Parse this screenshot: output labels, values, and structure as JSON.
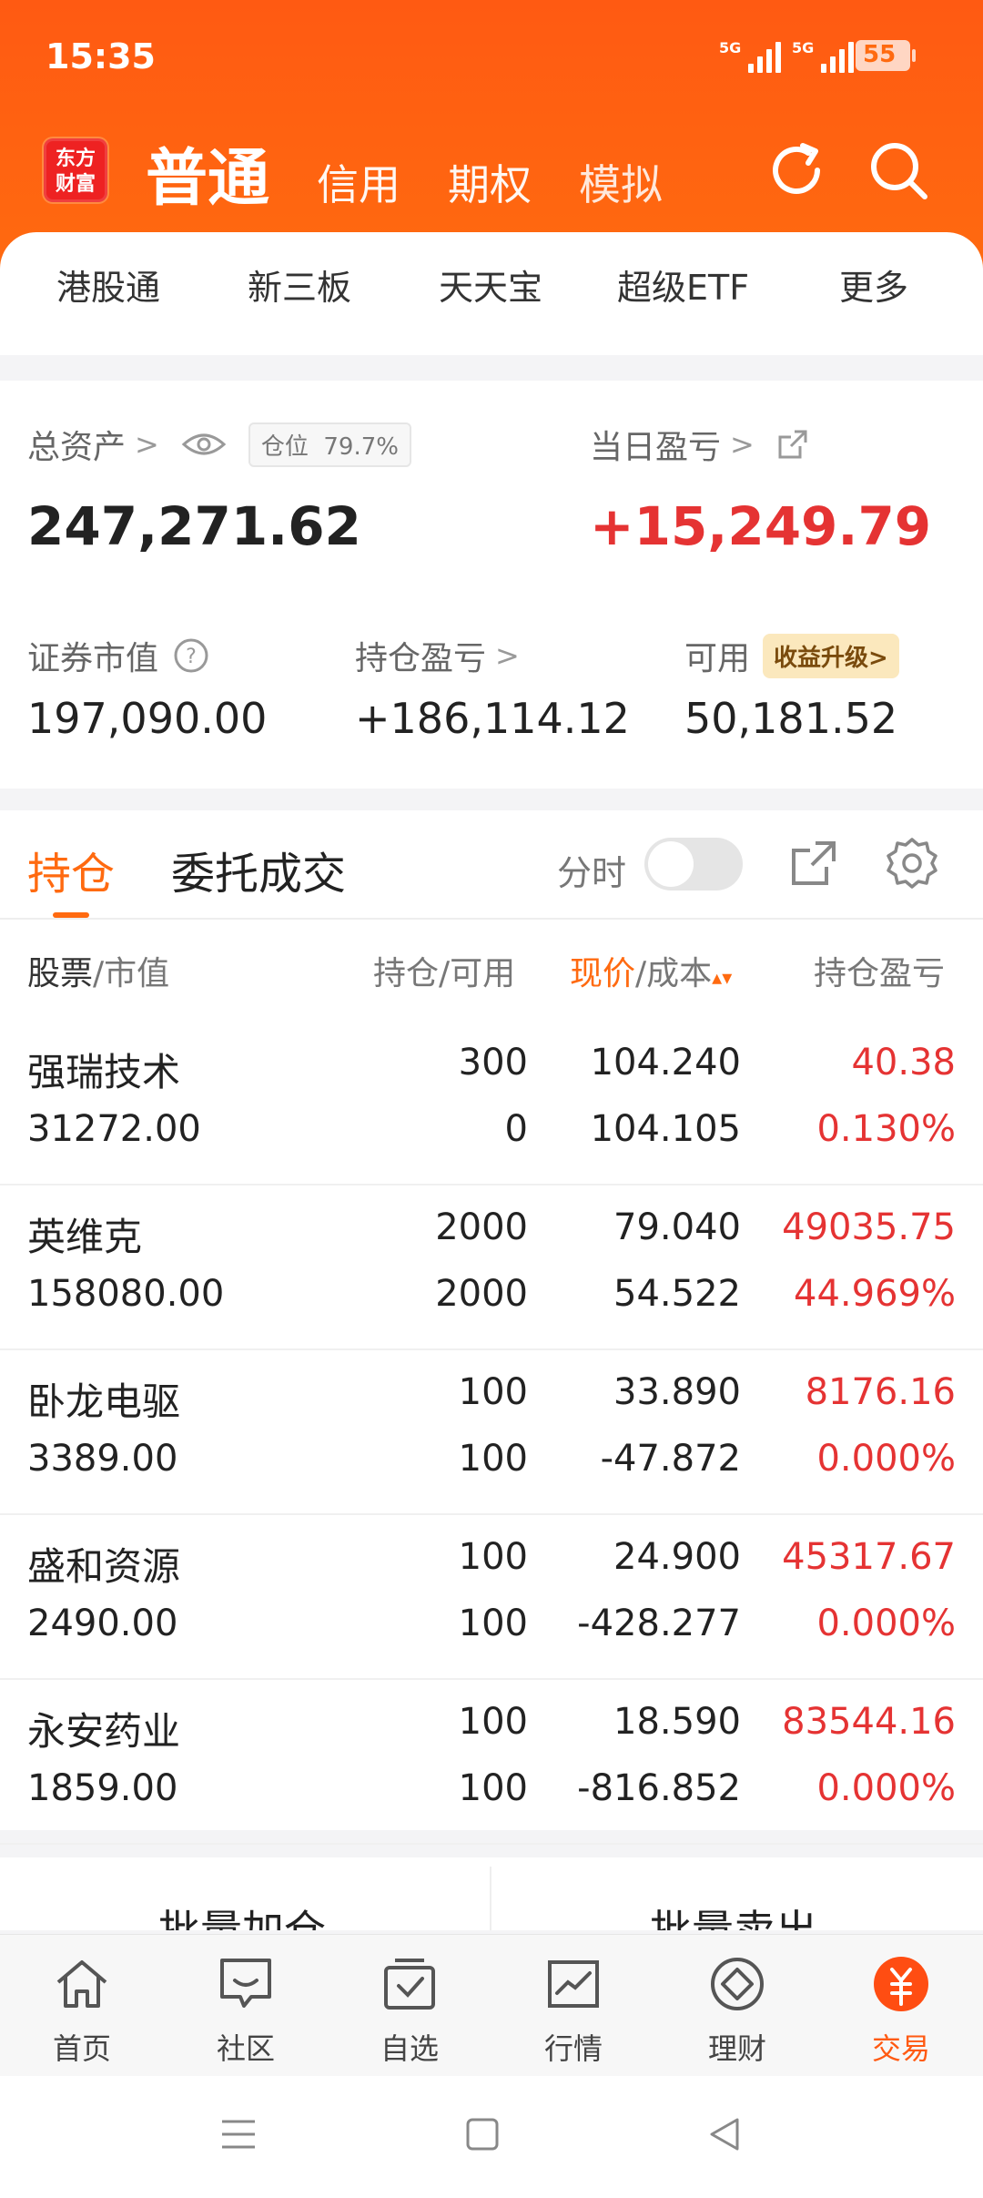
{
  "status": {
    "time": "15:35",
    "sig1": "5G",
    "sig2": "5G",
    "battery": "55"
  },
  "header": {
    "logo": [
      "东方",
      "财富"
    ],
    "tabs": [
      "普通",
      "信用",
      "期权",
      "模拟"
    ]
  },
  "quick_menu": [
    "港股通",
    "新三板",
    "天天宝",
    "超级ETF",
    "更多"
  ],
  "asset": {
    "total_label": "总资产",
    "position_label": "仓位",
    "position_value": "79.7%",
    "total_value": "247,271.62",
    "daily_label": "当日盈亏",
    "daily_value": "+15,249.79",
    "market_label": "证券市值",
    "market_value": "197,090.00",
    "hold_pl_label": "持仓盈亏",
    "hold_pl_value": "+186,114.12",
    "avail_label": "可用",
    "upgrade_label": "收益升级>",
    "avail_value": "50,181.52"
  },
  "holdings": {
    "tabs": [
      "持仓",
      "委托成交"
    ],
    "fenshi_label": "分时",
    "columns": {
      "stock": "股票",
      "stock_sub": "/市值",
      "qty": "持仓/可用",
      "price": "现价",
      "price_sub": "/成本",
      "pl": "持仓盈亏"
    },
    "rows": [
      {
        "name": "强瑞技术",
        "mv": "31272.00",
        "qty": "300",
        "avail": "0",
        "price": "104.240",
        "cost": "104.105",
        "pl": "40.38",
        "pl_pct": "0.130%"
      },
      {
        "name": "英维克",
        "mv": "158080.00",
        "qty": "2000",
        "avail": "2000",
        "price": "79.040",
        "cost": "54.522",
        "pl": "49035.75",
        "pl_pct": "44.969%"
      },
      {
        "name": "卧龙电驱",
        "mv": "3389.00",
        "qty": "100",
        "avail": "100",
        "price": "33.890",
        "cost": "-47.872",
        "pl": "8176.16",
        "pl_pct": "0.000%"
      },
      {
        "name": "盛和资源",
        "mv": "2490.00",
        "qty": "100",
        "avail": "100",
        "price": "24.900",
        "cost": "-428.277",
        "pl": "45317.67",
        "pl_pct": "0.000%"
      },
      {
        "name": "永安药业",
        "mv": "1859.00",
        "qty": "100",
        "avail": "100",
        "price": "18.590",
        "cost": "-816.852",
        "pl": "83544.16",
        "pl_pct": "0.000%"
      }
    ]
  },
  "batch": {
    "add": "批量加仓",
    "sell": "批量卖出"
  },
  "nav": [
    {
      "label": "首页",
      "icon": "home-icon"
    },
    {
      "label": "社区",
      "icon": "community-icon"
    },
    {
      "label": "自选",
      "icon": "watchlist-icon"
    },
    {
      "label": "行情",
      "icon": "market-icon"
    },
    {
      "label": "理财",
      "icon": "wealth-icon"
    },
    {
      "label": "交易",
      "icon": "trade-icon"
    }
  ],
  "colors": {
    "brand": "#ff6a10",
    "up": "#e53333"
  }
}
